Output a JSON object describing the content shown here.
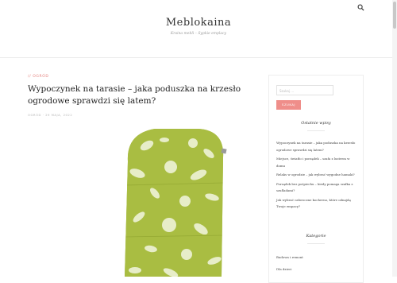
{
  "site": {
    "title": "Meblokaina",
    "tagline": "Kraina mebli – Sypkie emplacy"
  },
  "header": {
    "search_icon": "search-icon"
  },
  "post": {
    "category": "// Ogród",
    "title": "Wypoczynek na tarasie – jaka poduszka na krzesło ogrodowe sprawdzi się latem?",
    "meta": "Ogród · 29 maja, 2022",
    "image_alt": "Zielona poduszka na krzesło ogrodowe w białe kwiaty"
  },
  "sidebar": {
    "search": {
      "placeholder": "Szukaj …",
      "button_label": "Szukaj"
    },
    "recent": {
      "title": "Ostatnie wpisy",
      "items": [
        "Wypoczynek na tarasie – jaka poduszka na krzesło ogrodowe sprawdzi się latem?",
        "Miejsce, światło i porządek – szafa z lustrem w domu",
        "Relaks w ogrodzie – jak wybrać wygodne hamaki?",
        "Porządek bez pośpiechu – kiedy pomaga szafka z szufladami?",
        "Jak wybrać całoroczne kocherno, które odnajdą Twoje empacy?"
      ]
    },
    "categories": {
      "title": "Kategorie",
      "items": [
        "Budowa i remont",
        "Dla dzieci"
      ]
    }
  },
  "colors": {
    "accent": "#ef8e8a",
    "cushion_green": "#a3b83c"
  }
}
